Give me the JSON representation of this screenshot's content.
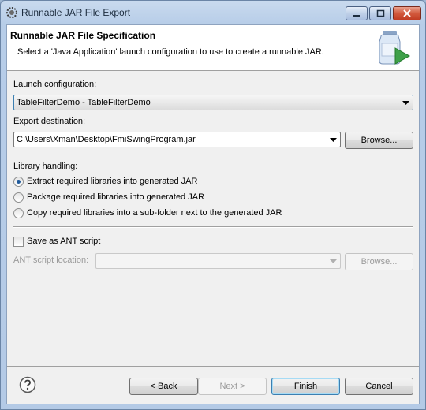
{
  "window": {
    "title": "Runnable JAR File Export"
  },
  "header": {
    "title": "Runnable JAR File Specification",
    "description": "Select a 'Java Application' launch configuration to use to create a runnable JAR."
  },
  "launch": {
    "label": "Launch configuration:",
    "selected": "TableFilterDemo - TableFilterDemo"
  },
  "export": {
    "label": "Export destination:",
    "path": "C:\\Users\\Xman\\Desktop\\FmiSwingProgram.jar",
    "browse": "Browse..."
  },
  "library": {
    "label": "Library handling:",
    "options": [
      "Extract required libraries into generated JAR",
      "Package required libraries into generated JAR",
      "Copy required libraries into a sub-folder next to the generated JAR"
    ],
    "selected_index": 0
  },
  "ant": {
    "checkbox_label": "Save as ANT script",
    "checked": false,
    "location_label": "ANT script location:",
    "browse": "Browse..."
  },
  "footer": {
    "back": "< Back",
    "next": "Next >",
    "finish": "Finish",
    "cancel": "Cancel"
  },
  "colors": {
    "accent": "#3c7fb1",
    "radio_dot": "#1f5a9b"
  }
}
